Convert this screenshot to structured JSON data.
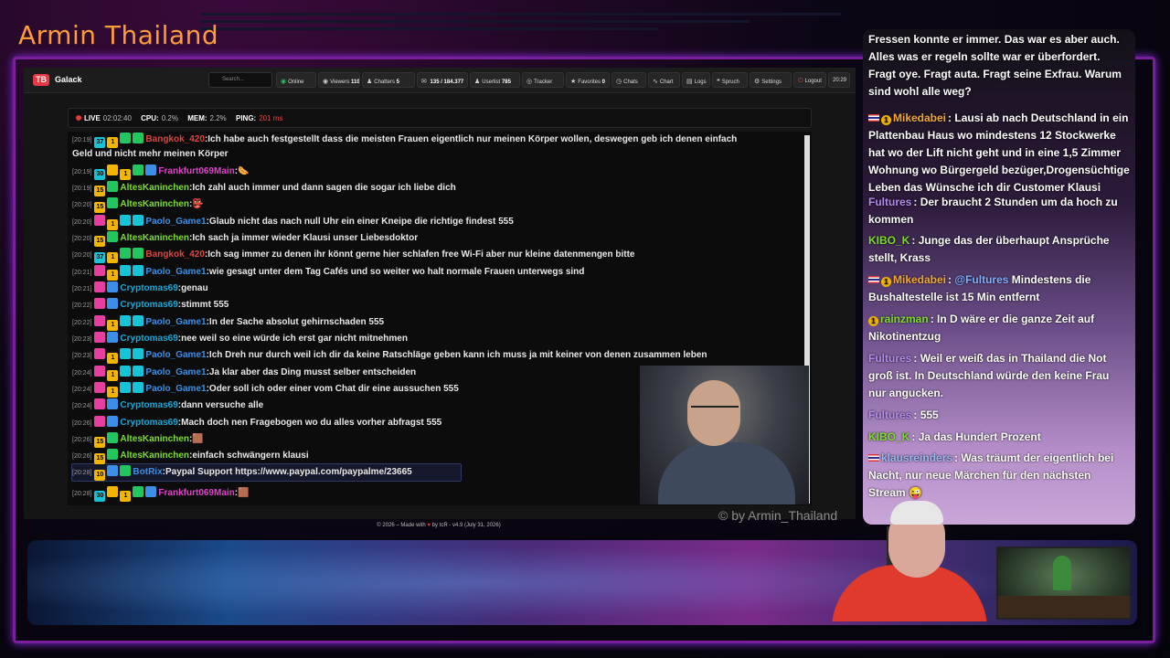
{
  "stream_title": "Armin Thailand",
  "watermark": "© by Armin_Thailand",
  "app": {
    "logo_text": "TB",
    "name": "Galack",
    "search_placeholder": "Search...",
    "toolbar": [
      {
        "label": "Online",
        "icon": "broadcast-icon",
        "glyph": "◉"
      },
      {
        "label": "Viewers",
        "value": "110",
        "icon": "eye-icon",
        "glyph": "◉"
      },
      {
        "label": "Chatters",
        "value": "5",
        "icon": "users-icon",
        "glyph": "♟"
      },
      {
        "label": "",
        "value": "135 / 184.377",
        "icon": "message-icon",
        "glyph": "✉"
      },
      {
        "label": "Userlist",
        "value": "785",
        "icon": "userlist-icon",
        "glyph": "♟"
      },
      {
        "label": "Tracker",
        "icon": "tracker-icon",
        "glyph": "◎"
      },
      {
        "label": "Favorites",
        "value": "0",
        "icon": "star-icon",
        "glyph": "★"
      },
      {
        "label": "Chats",
        "icon": "chat-icon",
        "glyph": "◷"
      },
      {
        "label": "Chart",
        "icon": "chart-icon",
        "glyph": "∿"
      },
      {
        "label": "Logs",
        "icon": "logs-icon",
        "glyph": "▤"
      },
      {
        "label": "Spruch",
        "icon": "quote-icon",
        "glyph": "❝"
      },
      {
        "label": "Settings",
        "icon": "gear-icon",
        "glyph": "⚙"
      },
      {
        "label": "Logout",
        "icon": "logout-icon",
        "glyph": "⏻"
      },
      {
        "label": "20:29",
        "icon": "clock-icon",
        "glyph": ""
      }
    ],
    "status": {
      "live_label": "LIVE",
      "live_value": "02:02:40",
      "cpu_label": "CPU:",
      "cpu_value": "0.2%",
      "mem_label": "MEM:",
      "mem_value": "2.2%",
      "ping_label": "PING:",
      "ping_value": "201 ms"
    },
    "footer": {
      "prefix": "© 2026 – Made with",
      "suffix": "by tcR - v4.9 (July 31, 2026)"
    }
  },
  "colors": {
    "title": "#ff9c3a",
    "accent": "#8a2be2",
    "badge_green": "#22c55e",
    "badge_cyan": "#17c3d6",
    "badge_yellow": "#f2b600",
    "badge_pink": "#e63fa0",
    "user_red": "#e0443c",
    "user_green": "#7ddc2e",
    "user_blue": "#3b8fe6",
    "user_magenta": "#e043c9"
  },
  "chat": [
    {
      "time": "[20:19]",
      "badges": [
        "#17c3d6:37",
        "#f2b600:1",
        "#22c55e:",
        "#22c55e:"
      ],
      "user": "Bangkok_420",
      "user_color": "#e0443c",
      "text": "Ich habe auch festgestellt dass die meisten Frauen eigentlich nur meinen Körper wollen, deswegen geb ich denen einfach",
      "text2": "Geld und nicht mehr meinen Körper"
    },
    {
      "time": "[20:19]",
      "badges": [
        "#17c3d6:30",
        "#f2b600:",
        "#f2b600:1",
        "#22c55e:",
        "#3b8fe6:"
      ],
      "user": "Frankfurt069Main",
      "user_color": "#e043c9",
      "text": "🌭"
    },
    {
      "time": "[20:19]",
      "badges": [
        "#f2b600:15",
        "#22c55e:"
      ],
      "user": "AltesKaninchen",
      "user_color": "#7ddc2e",
      "text": "Ich zahl auch immer und dann sagen die sogar ich liebe dich"
    },
    {
      "time": "[20:20]",
      "badges": [
        "#f2b600:15",
        "#22c55e:"
      ],
      "user": "AltesKaninchen",
      "user_color": "#7ddc2e",
      "text": "👺"
    },
    {
      "time": "[20:20]",
      "badges": [
        "#e63fa0:",
        "#f2b600:1",
        "#17c3d6:",
        "#17c3d6:"
      ],
      "user": "Paolo_Game1",
      "user_color": "#3b8fe6",
      "text": "Glaub nicht das nach null Uhr ein einer Kneipe die richtige findest 555"
    },
    {
      "time": "[20:20]",
      "badges": [
        "#f2b600:15",
        "#22c55e:"
      ],
      "user": "AltesKaninchen",
      "user_color": "#7ddc2e",
      "text": "Ich sach ja immer wieder Klausi unser Liebesdoktor"
    },
    {
      "time": "[20:20]",
      "badges": [
        "#17c3d6:37",
        "#f2b600:1",
        "#22c55e:",
        "#22c55e:"
      ],
      "user": "Bangkok_420",
      "user_color": "#e0443c",
      "text": "Ich sag immer zu denen ihr könnt gerne hier schlafen free Wi-Fi aber nur kleine datenmengen bitte"
    },
    {
      "time": "[20:21]",
      "badges": [
        "#e63fa0:",
        "#f2b600:1",
        "#17c3d6:",
        "#17c3d6:"
      ],
      "user": "Paolo_Game1",
      "user_color": "#3b8fe6",
      "text": "wie gesagt unter dem Tag Cafés und so weiter wo halt normale Frauen unterwegs sind"
    },
    {
      "time": "[20:21]",
      "badges": [
        "#e63fa0:",
        "#3b8fe6:"
      ],
      "user": "Cryptomas69",
      "user_color": "#17a8d6",
      "text": "genau"
    },
    {
      "time": "[20:22]",
      "badges": [
        "#e63fa0:",
        "#3b8fe6:"
      ],
      "user": "Cryptomas69",
      "user_color": "#17a8d6",
      "text": "stimmt 555"
    },
    {
      "time": "[20:22]",
      "badges": [
        "#e63fa0:",
        "#f2b600:1",
        "#17c3d6:",
        "#17c3d6:"
      ],
      "user": "Paolo_Game1",
      "user_color": "#3b8fe6",
      "text": "In der Sache absolut gehirnschaden 555"
    },
    {
      "time": "[20:23]",
      "badges": [
        "#e63fa0:",
        "#3b8fe6:"
      ],
      "user": "Cryptomas69",
      "user_color": "#17a8d6",
      "text": "nee weil so eine würde ich erst gar nicht mitnehmen"
    },
    {
      "time": "[20:23]",
      "badges": [
        "#e63fa0:",
        "#f2b600:1",
        "#17c3d6:",
        "#17c3d6:"
      ],
      "user": "Paolo_Game1",
      "user_color": "#3b8fe6",
      "text": "Ich Dreh nur durch weil ich dir da keine Ratschläge geben kann ich muss ja mit keiner von denen zusammen leben"
    },
    {
      "time": "[20:24]",
      "badges": [
        "#e63fa0:",
        "#f2b600:1",
        "#17c3d6:",
        "#17c3d6:"
      ],
      "user": "Paolo_Game1",
      "user_color": "#3b8fe6",
      "text": "Ja klar aber das Ding musst selber entscheiden"
    },
    {
      "time": "[20:24]",
      "badges": [
        "#e63fa0:",
        "#f2b600:1",
        "#17c3d6:",
        "#17c3d6:"
      ],
      "user": "Paolo_Game1",
      "user_color": "#3b8fe6",
      "text": "Oder soll ich oder einer vom Chat dir eine aussuchen 555"
    },
    {
      "time": "[20:24]",
      "badges": [
        "#e63fa0:",
        "#3b8fe6:"
      ],
      "user": "Cryptomas69",
      "user_color": "#17a8d6",
      "text": "dann versuche alle"
    },
    {
      "time": "[20:26]",
      "badges": [
        "#e63fa0:",
        "#3b8fe6:"
      ],
      "user": "Cryptomas69",
      "user_color": "#17a8d6",
      "text": "Mach doch nen Fragebogen wo du alles vorher abfragst 555"
    },
    {
      "time": "[20:26]",
      "badges": [
        "#f2b600:15",
        "#22c55e:"
      ],
      "user": "AltesKaninchen",
      "user_color": "#7ddc2e",
      "text": "🟫"
    },
    {
      "time": "[20:26]",
      "badges": [
        "#f2b600:15",
        "#22c55e:"
      ],
      "user": "AltesKaninchen",
      "user_color": "#7ddc2e",
      "text": "einfach schwängern klausi"
    },
    {
      "time": "[20:28]",
      "badges": [
        "#f2b600:10",
        "#3b8fe6:",
        "#22c55e:"
      ],
      "user": "BotRix",
      "user_color": "#3b8fe6",
      "text": "Paypal Support https://www.paypal.com/paypalme/23665"
    },
    {
      "time": "[20:28]",
      "badges": [
        "#17c3d6:30",
        "#f2b600:",
        "#f2b600:1",
        "#22c55e:",
        "#3b8fe6:"
      ],
      "user": "Frankfurt069Main",
      "user_color": "#e043c9",
      "text": "🟫"
    }
  ],
  "side_chat": [
    {
      "lines": "Fressen konnte er immer. Das war es aber auch. Alles was er regeln sollte war er überfordert. Fragt oye. Fragt auta. Fragt seine Exfrau. Warum sind wohl alle weg?"
    },
    {
      "flag": true,
      "coin": "1",
      "user": "Mikedabei",
      "user_color": "#f2a93a",
      "text": "Lausi ab nach Deutschland in ein Plattenbau Haus wo mindestens 12 Stockwerke hat wo der Lift nicht geht und in eine 1,5 Zimmer Wohnung wo Bürgergeld bezüger,Drogensüchtige Leben das Wünsche ich dir Customer Klausi"
    },
    {
      "user": "Fultures",
      "user_color": "#b48cf0",
      "text": "Der braucht 2 Stunden um da hoch zu kommen"
    },
    {
      "user": "KIBO_K",
      "user_color": "#7ddc2e",
      "text": "Junge das der überhaupt Ansprüche stellt, Krass"
    },
    {
      "flag": true,
      "coin": "1",
      "user": "Mikedabei",
      "user_color": "#f2a93a",
      "mention": "@Fultures",
      "text": "Mindestens die Bushaltestelle ist 15 Min entfernt"
    },
    {
      "coin": "1",
      "user": "rainzman",
      "user_color": "#7ddc2e",
      "text": "In D wäre er die ganze Zeit auf Nikotinentzug"
    },
    {
      "user": "Fultures",
      "user_color": "#b48cf0",
      "text": "Weil er weiß das in Thailand die Not groß ist. In Deutschland würde den keine Frau nur angucken."
    },
    {
      "user": "Fultures",
      "user_color": "#b48cf0",
      "text": "555"
    },
    {
      "user": "KIBO_K",
      "user_color": "#7ddc2e",
      "text": "Ja das Hundert Prozent"
    },
    {
      "flag": true,
      "user": "klausreinders",
      "user_color": "#9ab8f0",
      "text": "Was träumt der eigentlich bei Nacht, nur neue Märchen für den nächsten Stream 😜"
    }
  ]
}
